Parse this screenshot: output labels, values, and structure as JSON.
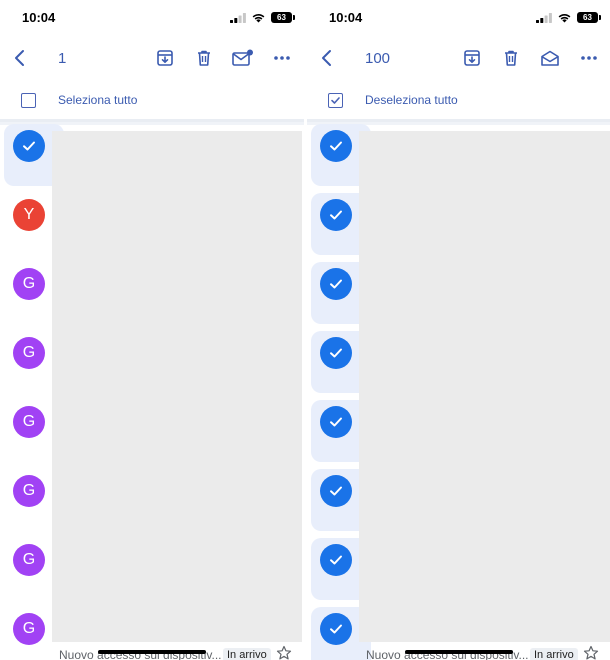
{
  "left": {
    "status": {
      "time": "10:04",
      "battery": "63"
    },
    "toolbar": {
      "selected_count": "1"
    },
    "select_all_label": "Seleziona tutto",
    "list": {
      "avatars": [
        {
          "letter": "",
          "selected": true
        },
        {
          "letter": "Y",
          "selected": false,
          "color": "#ea4335"
        },
        {
          "letter": "G",
          "selected": false,
          "color": "#a142f4"
        },
        {
          "letter": "G",
          "selected": false,
          "color": "#a142f4"
        },
        {
          "letter": "G",
          "selected": false,
          "color": "#a142f4"
        },
        {
          "letter": "G",
          "selected": false,
          "color": "#a142f4"
        },
        {
          "letter": "G",
          "selected": false,
          "color": "#a142f4"
        },
        {
          "letter": "G",
          "selected": false,
          "color": "#a142f4"
        }
      ],
      "preview": {
        "snippet": "Nuovo accesso sul dispositiv...",
        "label": "In arrivo"
      }
    }
  },
  "right": {
    "status": {
      "time": "10:04",
      "battery": "63"
    },
    "toolbar": {
      "selected_count": "100"
    },
    "deselect_all_label": "Deseleziona tutto",
    "list": {
      "avatars": [
        {
          "letter": "",
          "selected": true
        },
        {
          "letter": "",
          "selected": true
        },
        {
          "letter": "",
          "selected": true
        },
        {
          "letter": "",
          "selected": true
        },
        {
          "letter": "",
          "selected": true
        },
        {
          "letter": "",
          "selected": true
        },
        {
          "letter": "",
          "selected": true
        },
        {
          "letter": "",
          "selected": true
        }
      ],
      "preview": {
        "snippet": "Nuovo accesso sul dispositiv...",
        "label": "In arrivo"
      }
    }
  },
  "colors": {
    "accent": "#1a73e8",
    "toolbar_icon": "#3b5bb0",
    "selected_row_bg": "#e8eefb",
    "avatar_y": "#ea4335",
    "avatar_g": "#a142f4"
  },
  "icons": [
    "back-arrow-icon",
    "archive-icon",
    "trash-icon",
    "mark-unread-icon",
    "mark-read-icon",
    "more-icon",
    "checkbox-icon",
    "check-icon",
    "star-icon",
    "signal-icon",
    "wifi-icon",
    "battery-icon"
  ]
}
